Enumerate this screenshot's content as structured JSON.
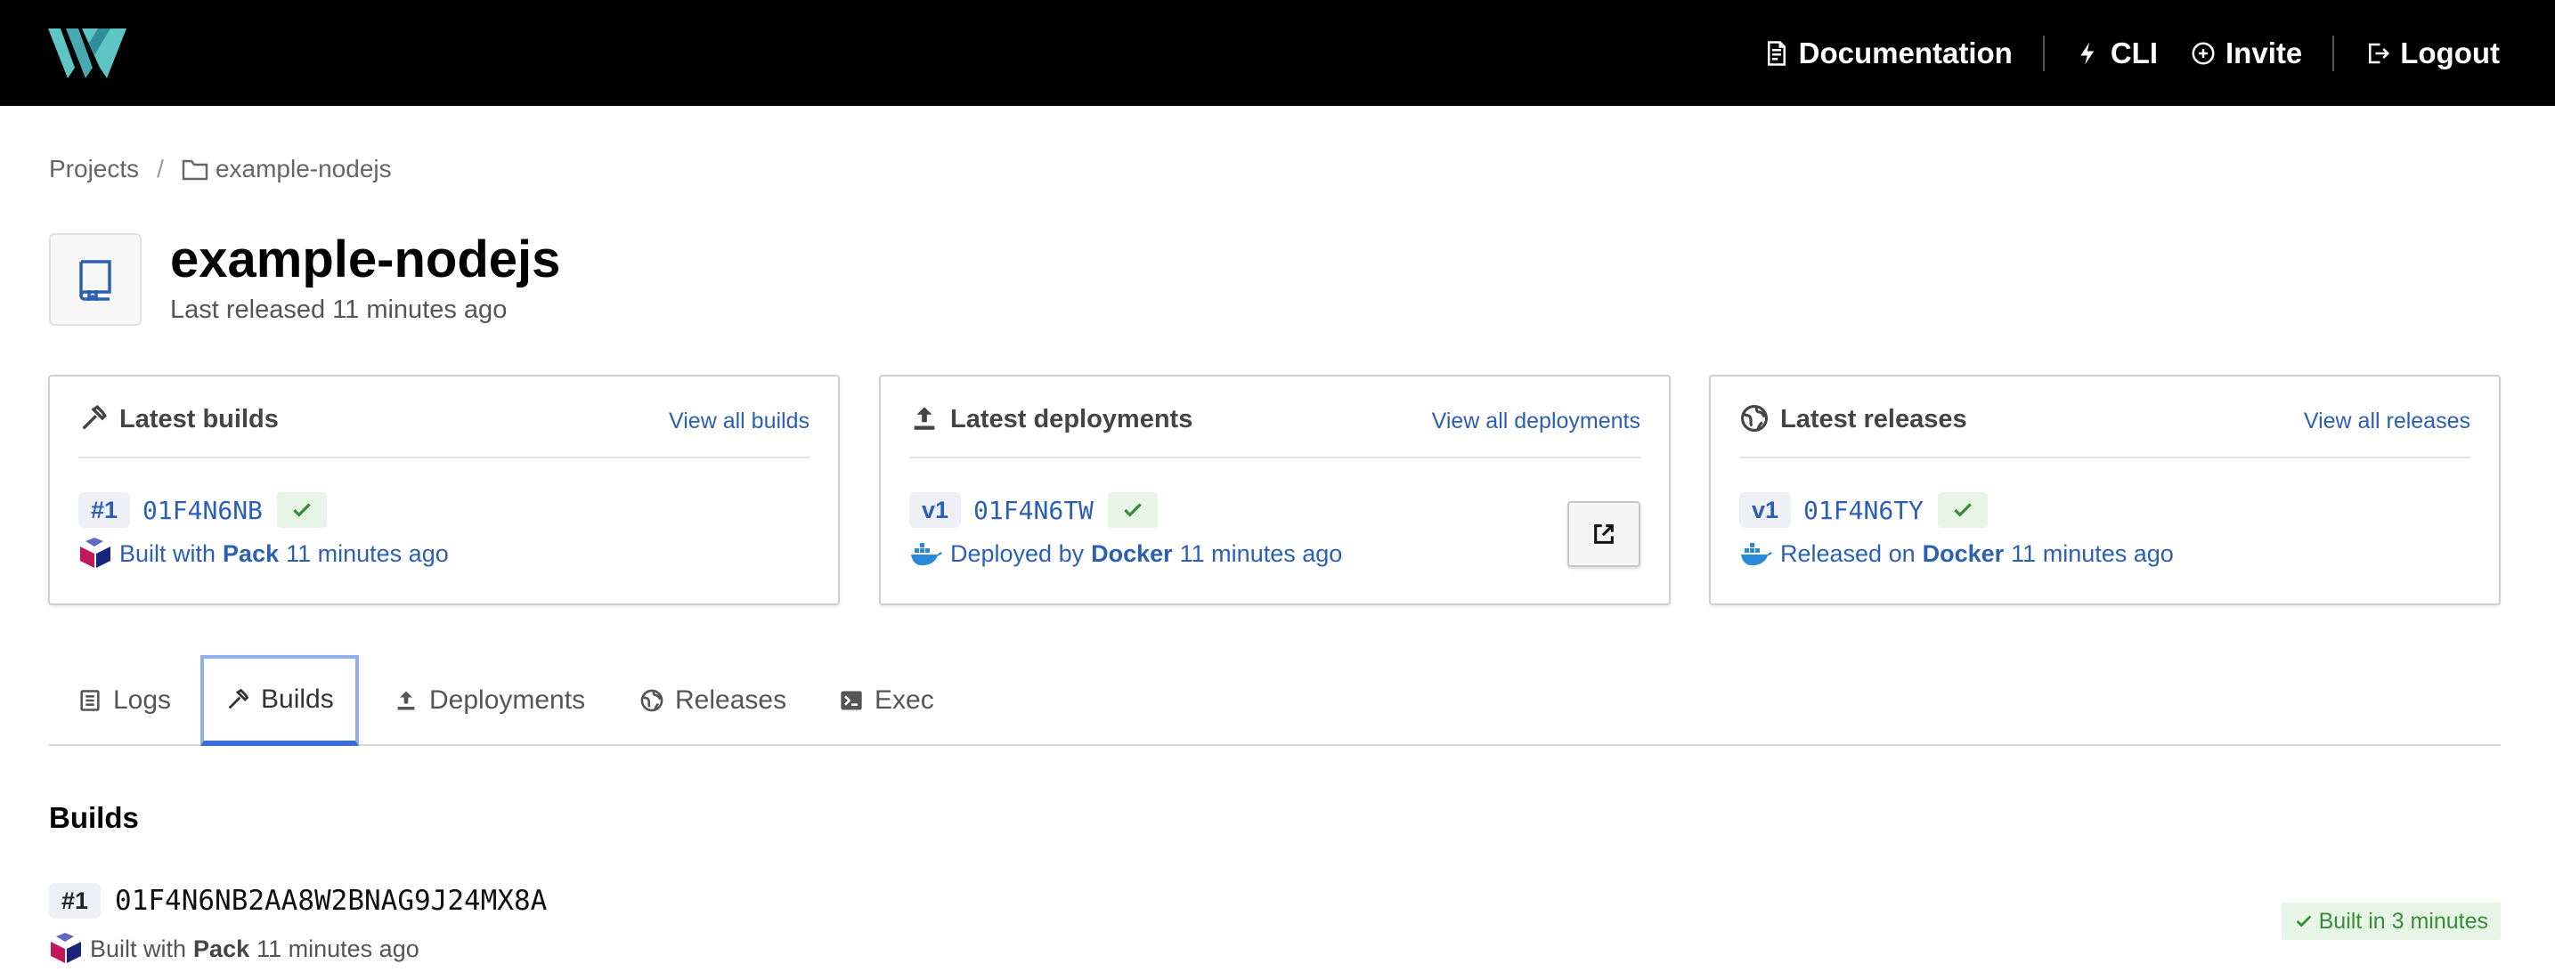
{
  "topbar": {
    "logo_icon": "waypoint-logo-icon",
    "nav": {
      "documentation": "Documentation",
      "cli": "CLI",
      "invite": "Invite",
      "logout": "Logout"
    }
  },
  "breadcrumb": {
    "projects": "Projects",
    "separator": "/",
    "current": "example-nodejs"
  },
  "project": {
    "name": "example-nodejs",
    "last_released": "Last released 11 minutes ago"
  },
  "cards": {
    "builds": {
      "title": "Latest builds",
      "link": "View all builds",
      "badge": "#1",
      "id": "01F4N6NB",
      "meta_prefix": "Built with",
      "meta_tool": "Pack",
      "meta_time": "11 minutes ago"
    },
    "deployments": {
      "title": "Latest deployments",
      "link": "View all deployments",
      "badge": "v1",
      "id": "01F4N6TW",
      "meta_prefix": "Deployed by",
      "meta_tool": "Docker",
      "meta_time": "11 minutes ago"
    },
    "releases": {
      "title": "Latest releases",
      "link": "View all releases",
      "badge": "v1",
      "id": "01F4N6TY",
      "meta_prefix": "Released on",
      "meta_tool": "Docker",
      "meta_time": "11 minutes ago"
    }
  },
  "tabs": {
    "logs": "Logs",
    "builds": "Builds",
    "deployments": "Deployments",
    "releases": "Releases",
    "exec": "Exec",
    "active": "builds"
  },
  "builds_section": {
    "title": "Builds",
    "rows": [
      {
        "badge": "#1",
        "hash": "01F4N6NB2AA8W2BNAG9J24MX8A",
        "meta_prefix": "Built with",
        "meta_tool": "Pack",
        "meta_time": "11 minutes ago",
        "status": "Built in 3 minutes"
      }
    ]
  },
  "colors": {
    "topbar": "#000000",
    "brand_teal": "#5ec4c4",
    "link_blue": "#2b5fb4",
    "success_bg": "#e6f5e6",
    "success_text": "#3a8a3a",
    "active_tab": "#3a6fd8"
  }
}
